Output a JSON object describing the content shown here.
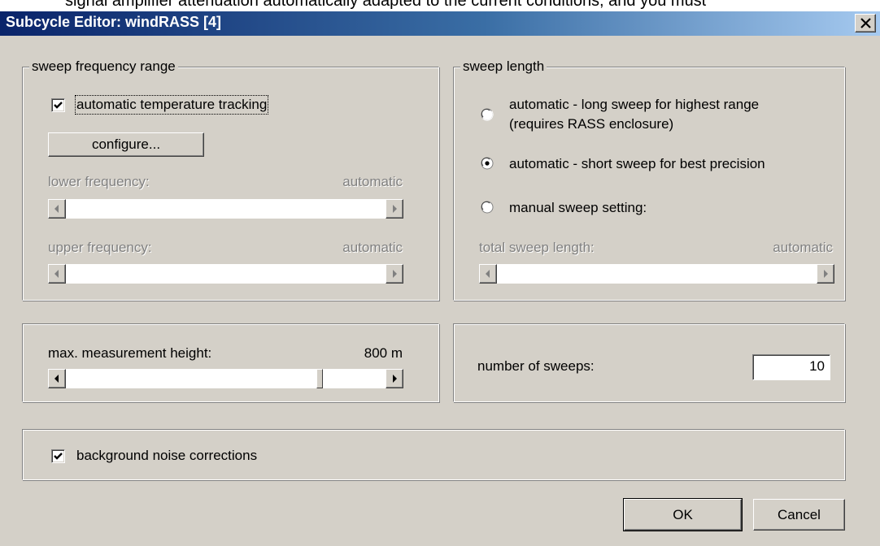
{
  "window": {
    "title": "Subcycle Editor: windRASS [4]",
    "background_strip_text": "signal amplifier attenuation automatically adapted to the current conditions, and you must"
  },
  "sweep_frequency_range": {
    "legend": "sweep frequency range",
    "auto_temp_tracking": {
      "label": "automatic temperature tracking",
      "checked": true
    },
    "configure_button": "configure...",
    "lower_frequency": {
      "label": "lower frequency:",
      "value": "automatic"
    },
    "upper_frequency": {
      "label": "upper frequency:",
      "value": "automatic"
    }
  },
  "sweep_length": {
    "legend": "sweep length",
    "options": [
      {
        "label": "automatic - long sweep for highest range (requires RASS enclosure)",
        "line1": "automatic - long sweep for highest range",
        "line2": "(requires RASS enclosure)",
        "selected": false
      },
      {
        "label": "automatic - short sweep for best precision",
        "selected": true
      },
      {
        "label": "manual sweep setting:",
        "selected": false
      }
    ],
    "total_sweep_length": {
      "label": "total sweep length:",
      "value": "automatic"
    }
  },
  "measurement": {
    "label": "max. measurement height:",
    "value": "800 m",
    "slider_position_fraction": 0.8
  },
  "sweeps": {
    "label": "number of sweeps:",
    "value": "10"
  },
  "noise": {
    "label": "background noise corrections",
    "checked": true
  },
  "buttons": {
    "ok": "OK",
    "cancel": "Cancel"
  },
  "colors": {
    "title_gradient_start": "#0a246a",
    "title_gradient_end": "#a6caf0",
    "dialog_bg": "#d4d0c8",
    "disabled_text": "#808080"
  }
}
